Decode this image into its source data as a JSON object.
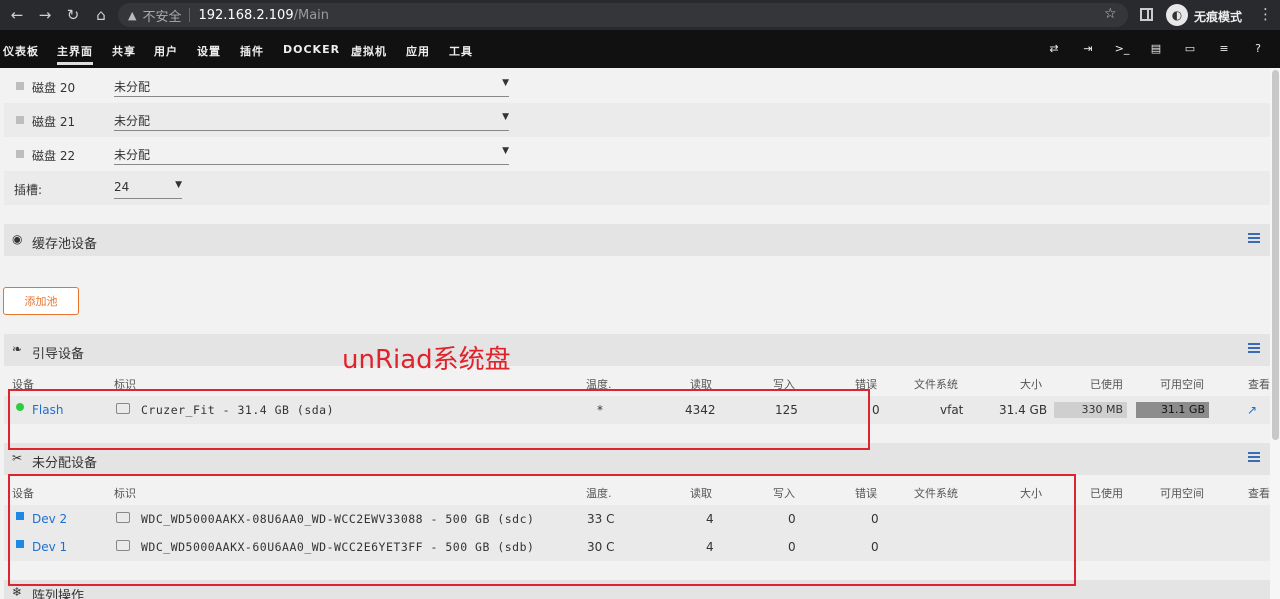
{
  "browser": {
    "back_icon": "←",
    "forward_icon": "→",
    "reload_icon": "↻",
    "home_icon": "⌂",
    "warning_icon": "▲",
    "security_label": "不安全",
    "host": "192.168.2.109",
    "path": "/Main",
    "star_icon": "☆",
    "incognito_icon": "◐",
    "incognito_label": "无痕模式",
    "menu_icon": "⋮"
  },
  "nav": {
    "items": [
      "仪表板",
      "主界面",
      "共享",
      "用户",
      "设置",
      "插件",
      "DOCKER",
      "虚拟机",
      "应用",
      "工具"
    ],
    "active": "主界面",
    "right_icons": [
      "⇄",
      "⇥",
      ">_",
      "▤",
      "▭",
      "≡",
      "?"
    ]
  },
  "disk_rows": [
    {
      "label": "磁盘 20",
      "value": "未分配",
      "arrow": "▼"
    },
    {
      "label": "磁盘 21",
      "value": "未分配",
      "arrow": "▼"
    },
    {
      "label": "磁盘 22",
      "value": "未分配",
      "arrow": "▼"
    }
  ],
  "slots": {
    "label": "插槽:",
    "value": "24",
    "arrow": "▼"
  },
  "pool": {
    "title": "缓存池设备",
    "icon": "◉",
    "add_button": "添加池"
  },
  "boot": {
    "title": "引导设备",
    "icon": "❧",
    "columns": [
      "设备",
      "标识",
      "温度.",
      "读取",
      "写入",
      "错误",
      "文件系统",
      "大小",
      "已使用",
      "可用空间",
      "查看"
    ],
    "rows": [
      {
        "device": "Flash",
        "status_color": "#2ecc40",
        "ident": "Cruzer_Fit - 31.4 GB (sda)",
        "temp": "*",
        "reads": "4342",
        "writes": "125",
        "errors": "0",
        "fs": "vfat",
        "size": "31.4 GB",
        "used": "330 MB",
        "free": "31.1 GB",
        "view_icon": "↗"
      }
    ]
  },
  "unassigned": {
    "title": "未分配设备",
    "icon": "✂",
    "columns": [
      "设备",
      "标识",
      "温度.",
      "读取",
      "写入",
      "错误",
      "文件系统",
      "大小",
      "已使用",
      "可用空间",
      "查看"
    ],
    "rows": [
      {
        "device": "Dev 2",
        "ident": "WDC_WD5000AAKX-08U6AA0_WD-WCC2EWV33088 - 500 GB (sdc)",
        "temp": "33 C",
        "reads": "4",
        "writes": "0",
        "errors": "0"
      },
      {
        "device": "Dev 1",
        "ident": "WDC_WD5000AAKX-60U6AA0_WD-WCC2E6YET3FF - 500 GB (sdb)",
        "temp": "30 C",
        "reads": "4",
        "writes": "0",
        "errors": "0"
      }
    ]
  },
  "array_ops": {
    "title": "阵列操作",
    "icon": "❄"
  },
  "annotation": {
    "text": "unRiad系统盘",
    "color": "#e0222b"
  }
}
